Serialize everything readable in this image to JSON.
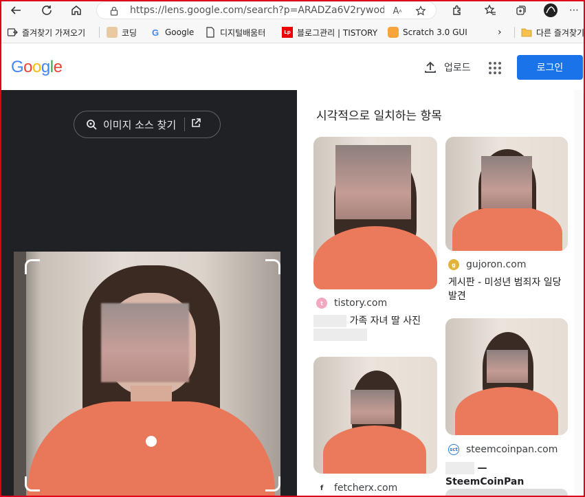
{
  "browser": {
    "url": "https://lens.google.com/search?p=ARADZa6V2rywodMEw..."
  },
  "bookmarks": [
    {
      "label": "즐겨찾기 가져오기",
      "icon": "import-icon"
    },
    {
      "label": "코딩",
      "icon": "dog-favicon-icon"
    },
    {
      "label": "Google",
      "icon": "google-favicon-icon"
    },
    {
      "label": "디지털배움터",
      "icon": "page-icon"
    },
    {
      "label": "블로그관리 | TISTORY",
      "icon": "tistory-favicon-icon"
    },
    {
      "label": "Scratch 3.0 GUI",
      "icon": "scratch-favicon-icon"
    },
    {
      "label": "다른 즐겨찾기",
      "icon": "folder-icon"
    }
  ],
  "header": {
    "logo": "Google",
    "upload_label": "업로드",
    "login_label": "로그인"
  },
  "left": {
    "find_source_label": "이미지 소스 찾기"
  },
  "results": {
    "title": "시각적으로 일치하는 항목",
    "items": [
      {
        "site": "tistory.com",
        "desc": "가족 자녀 딸 사진"
      },
      {
        "site": "gujoron.com",
        "desc": "게시판 - 미성년 범죄자 일당 발견"
      },
      {
        "site": "steemcoinpan.com",
        "desc": "— SteemCoinPan"
      },
      {
        "site": "fetcherx.com",
        "desc": ""
      }
    ]
  },
  "colors": {
    "accent": "#1a73e8",
    "dark_panel": "#202124",
    "frame": "#e0001a"
  }
}
